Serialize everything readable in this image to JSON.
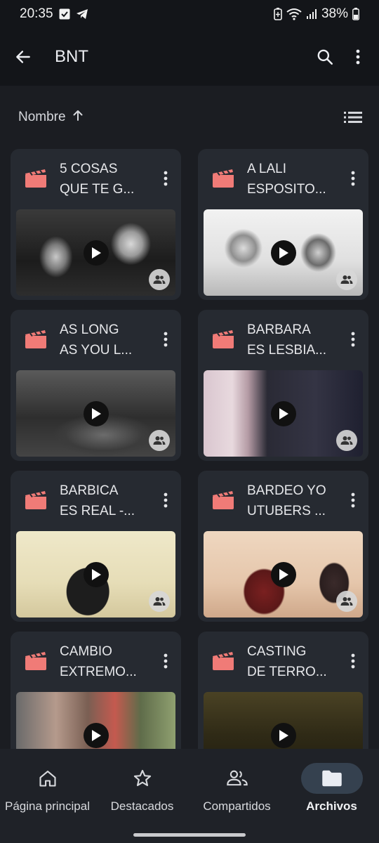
{
  "status": {
    "time": "20:35",
    "battery": "38%"
  },
  "appbar": {
    "title": "BNT"
  },
  "sort": {
    "label": "Nombre"
  },
  "files": [
    {
      "line1": "5 COSAS",
      "line2": "QUE TE G..."
    },
    {
      "line1": "A LALI",
      "line2": "ESPOSITO..."
    },
    {
      "line1": "AS LONG",
      "line2": "AS YOU L..."
    },
    {
      "line1": "BARBARA",
      "line2": "ES LESBIA..."
    },
    {
      "line1": "BARBICA",
      "line2": "ES REAL -..."
    },
    {
      "line1": "BARDEO YO",
      "line2": "UTUBERS ..."
    },
    {
      "line1": "CAMBIO",
      "line2": "EXTREMO..."
    },
    {
      "line1": "CASTING",
      "line2": "DE TERRO..."
    }
  ],
  "nav": [
    {
      "label": "Página principal",
      "icon": "home-icon"
    },
    {
      "label": "Destacados",
      "icon": "star-icon"
    },
    {
      "label": "Compartidos",
      "icon": "people-icon"
    },
    {
      "label": "Archivos",
      "icon": "folder-icon",
      "active": true
    }
  ],
  "colors": {
    "film_icon": "#f07b77",
    "active_nav": "#35414f"
  }
}
